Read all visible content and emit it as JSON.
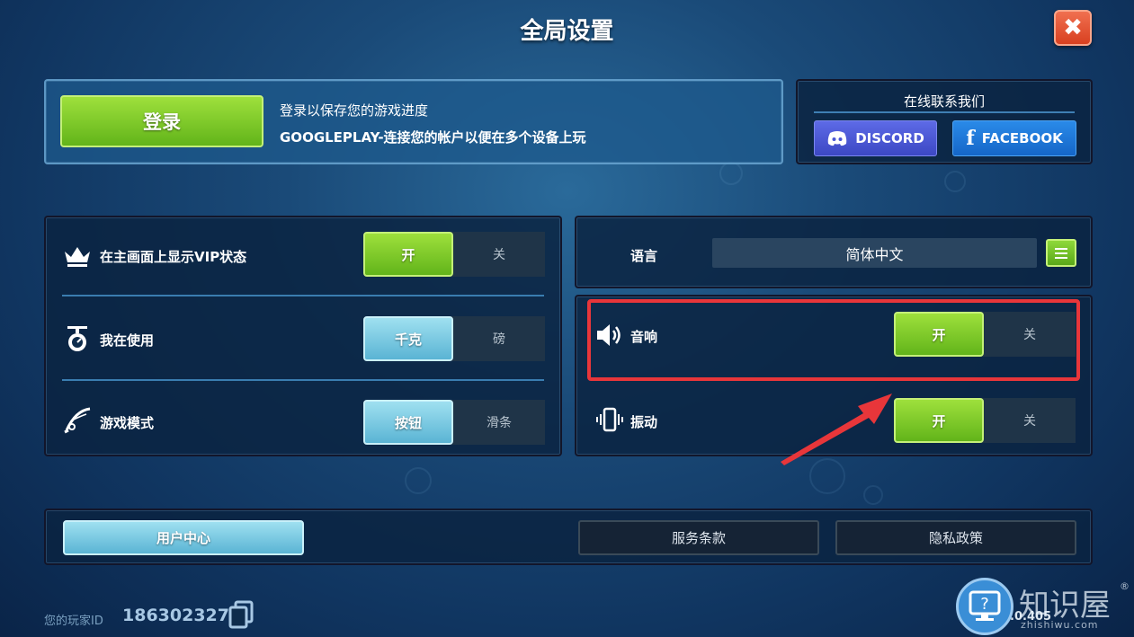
{
  "header": {
    "title": "全局设置",
    "close_icon": "close-icon"
  },
  "login": {
    "button_label": "登录",
    "line1": "登录以保存您的游戏进度",
    "line2": "GOOGLEPLAY-连接您的帐户以便在多个设备上玩"
  },
  "contact": {
    "title": "在线联系我们",
    "discord_label": "DISCORD",
    "facebook_label": "FACEBOOK",
    "facebook_glyph": "f"
  },
  "settings": {
    "vip": {
      "label": "在主画面上显示VIP状态",
      "on": "开",
      "off": "关",
      "selected": "on",
      "icon": "crown-icon"
    },
    "units": {
      "label": "我在使用",
      "on": "千克",
      "off": "磅",
      "selected": "on",
      "icon": "scale-icon"
    },
    "mode": {
      "label": "游戏模式",
      "on": "按钮",
      "off": "滑条",
      "selected": "on",
      "icon": "fishing-rod-icon"
    }
  },
  "language": {
    "label": "语言",
    "value": "简体中文",
    "icon": "menu-icon"
  },
  "sound": {
    "label": "音响",
    "on": "开",
    "off": "关",
    "selected": "on",
    "icon": "speaker-icon"
  },
  "vibration": {
    "label": "振动",
    "on": "开",
    "off": "关",
    "selected": "on",
    "icon": "vibration-icon"
  },
  "footer": {
    "user_center": "用户中心",
    "terms": "服务条款",
    "privacy": "隐私政策"
  },
  "player": {
    "label": "您的玩家ID",
    "id": "186302327"
  },
  "version": "1.0.405",
  "watermark": {
    "text": "知识屋",
    "reg": "®",
    "url": "zhishiwu.com"
  },
  "colors": {
    "accent_green": "#7cc82a",
    "accent_blue": "#7ccbe4",
    "highlight_red": "#e8363a"
  }
}
